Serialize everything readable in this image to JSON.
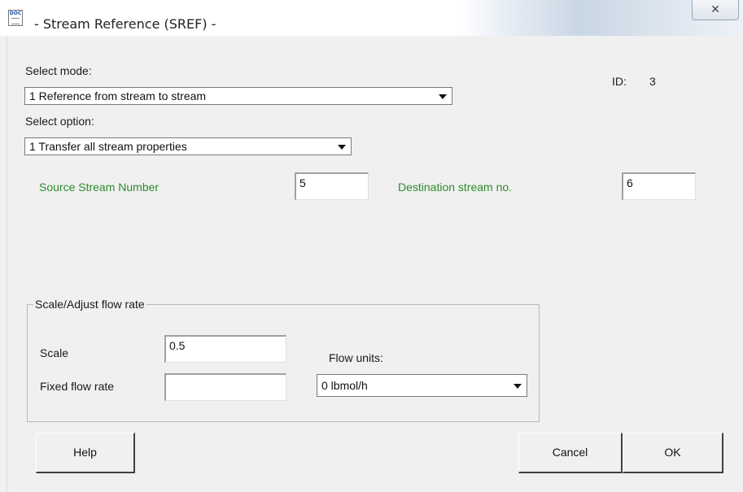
{
  "window": {
    "title": "- Stream Reference (SREF) -",
    "close_symbol": "✕",
    "icon": "document-icon",
    "icon_text": "DOC"
  },
  "mode": {
    "label": "Select mode:",
    "selected": "1 Reference from stream to stream"
  },
  "option": {
    "label": "Select option:",
    "selected": "1 Transfer all stream properties"
  },
  "id": {
    "label": "ID:",
    "value": "3"
  },
  "source": {
    "label": "Source Stream Number",
    "value": "5"
  },
  "destination": {
    "label": "Destination stream no.",
    "value": "6"
  },
  "scale_group": {
    "title": "Scale/Adjust flow rate",
    "scale_label": "Scale",
    "scale_value": "0.5",
    "fixed_label": "Fixed flow rate",
    "fixed_value": "",
    "units_label": "Flow units:",
    "units_selected": "0 lbmol/h"
  },
  "buttons": {
    "help": "Help",
    "cancel": "Cancel",
    "ok": "OK"
  },
  "colors": {
    "accent_label": "#2e8a2e"
  }
}
